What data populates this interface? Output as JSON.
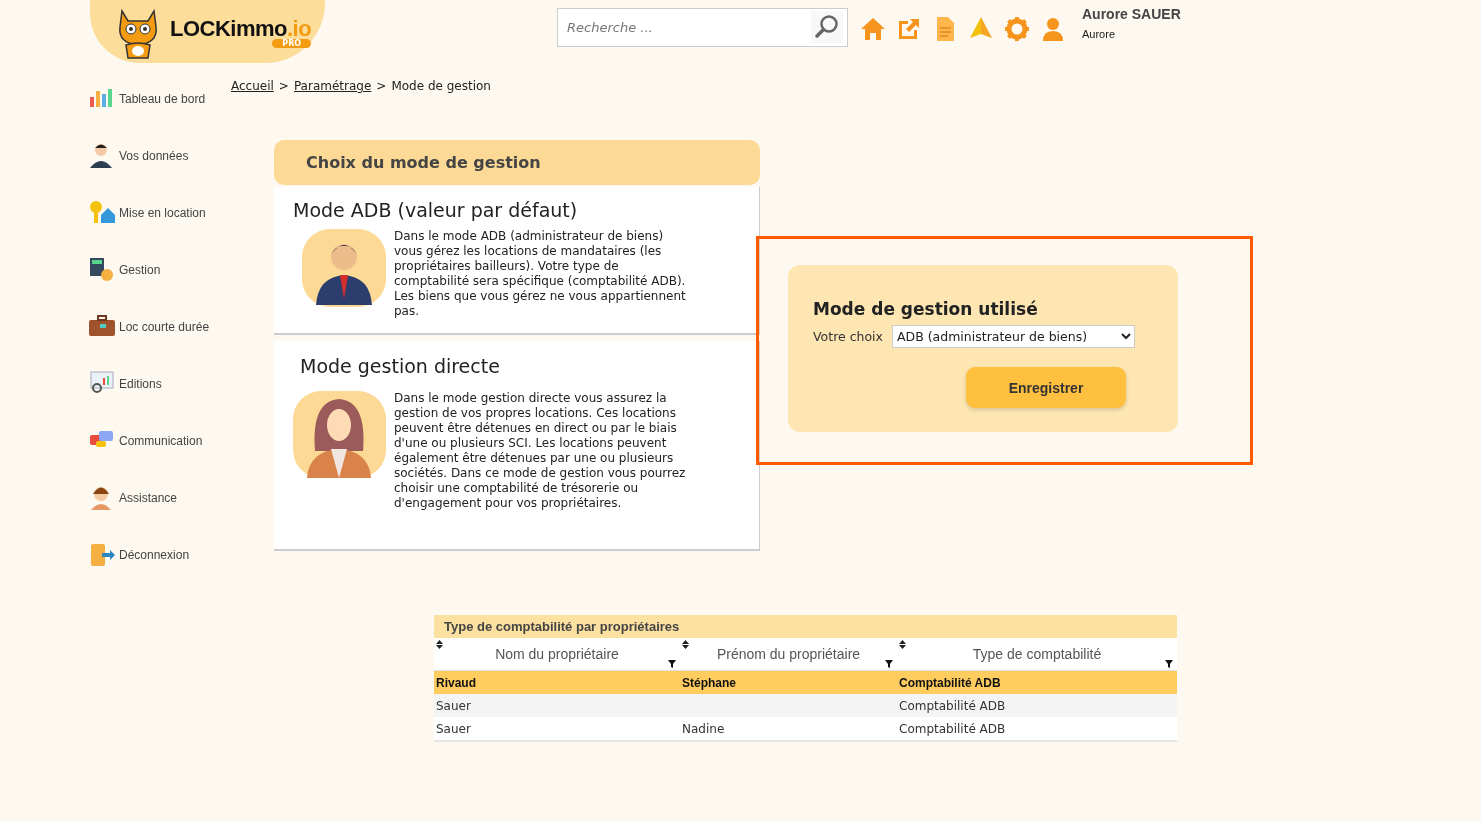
{
  "header": {
    "logo": {
      "name": "LOCKimmo",
      "suffix": ".io",
      "badge": "PRO"
    },
    "search": {
      "placeholder": "Recherche ..."
    },
    "user": {
      "name": "Aurore SAUER",
      "first_name": "Aurore"
    }
  },
  "sidebar": {
    "items": [
      {
        "label": "Tableau de bord"
      },
      {
        "label": "Vos données"
      },
      {
        "label": "Mise en location"
      },
      {
        "label": "Gestion"
      },
      {
        "label": "Loc courte durée"
      },
      {
        "label": "Editions"
      },
      {
        "label": "Communication"
      },
      {
        "label": "Assistance"
      },
      {
        "label": "Déconnexion"
      }
    ]
  },
  "breadcrumb": {
    "separator": ">",
    "items": [
      {
        "label": "Accueil",
        "link": true
      },
      {
        "label": "Paramétrage",
        "link": true
      },
      {
        "label": "Mode de gestion",
        "link": false
      }
    ]
  },
  "modes": {
    "title": "Choix du mode de gestion",
    "cards": [
      {
        "kind": "man",
        "title": "Mode ADB (valeur par défaut)",
        "text": "Dans le mode ADB (administrateur de biens) vous gérez les locations de mandataires (les propriétaires bailleurs). Votre type de comptabilité sera spécifique (comptabilité ADB). Les biens que vous gérez ne vous appartiennent pas."
      },
      {
        "kind": "woman",
        "title": "Mode gestion directe",
        "text": "Dans le mode gestion directe vous assurez la gestion de vos propres locations. Ces locations peuvent être détenues en direct ou par le biais d'une ou plusieurs SCI. Les locations peuvent également être détenues par une ou plusieurs sociétés. Dans ce mode de gestion vous pourrez choisir une comptabilité de trésorerie ou d'engagement pour vos propriétaires."
      }
    ]
  },
  "settings": {
    "highlighted": true,
    "title": "Mode de gestion utilisé",
    "label": "Votre choix",
    "value": "ADB (administrateur de biens)",
    "button": "Enregistrer"
  },
  "table": {
    "title": "Type de comptabilité par propriétaires",
    "columns": [
      "Nom du propriétaire",
      "Prénom du propriétaire",
      "Type de comptabilité"
    ],
    "rows": [
      {
        "selected": true,
        "cells": [
          "Rivaud",
          "Stéphane",
          "Comptabilité ADB"
        ]
      },
      {
        "selected": false,
        "cells": [
          "Sauer",
          null,
          "Comptabilité ADB"
        ]
      },
      {
        "selected": false,
        "cells": [
          "Sauer",
          "Nadine",
          "Comptabilité ADB"
        ]
      }
    ]
  }
}
